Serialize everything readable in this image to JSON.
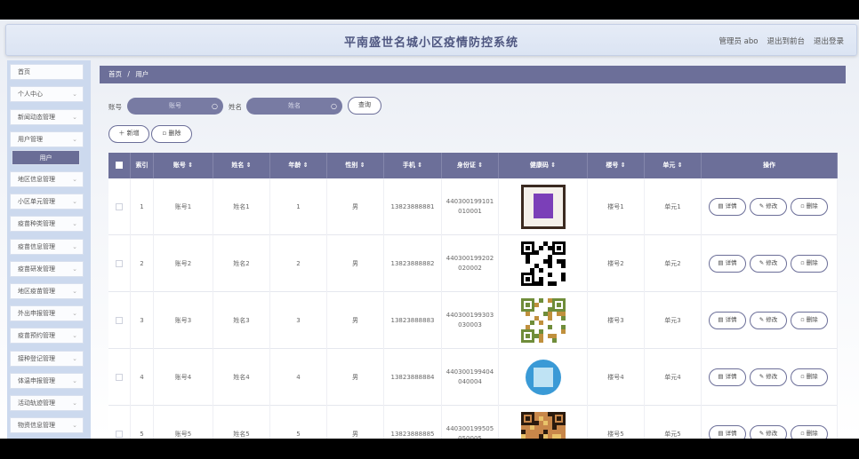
{
  "header": {
    "title": "平南盛世名城小区疫情防控系统",
    "user": "管理员 abo",
    "to_backend": "退出到前台",
    "logout": "退出登录"
  },
  "sidebar": {
    "items": [
      {
        "label": "首页",
        "chevron": false
      },
      {
        "label": "个人中心",
        "chevron": true
      },
      {
        "label": "新闻动态管理",
        "chevron": true
      },
      {
        "label": "用户管理",
        "chevron": true
      },
      {
        "label": "用户",
        "chevron": false,
        "active": true
      },
      {
        "label": "地区信息管理",
        "chevron": true
      },
      {
        "label": "小区单元管理",
        "chevron": true
      },
      {
        "label": "疫苗种类管理",
        "chevron": true
      },
      {
        "label": "疫苗信息管理",
        "chevron": true
      },
      {
        "label": "疫苗研发管理",
        "chevron": true
      },
      {
        "label": "地区疫苗管理",
        "chevron": true
      },
      {
        "label": "外出申报管理",
        "chevron": true
      },
      {
        "label": "疫苗预约管理",
        "chevron": true
      },
      {
        "label": "接种登记管理",
        "chevron": true
      },
      {
        "label": "体温申报管理",
        "chevron": true
      },
      {
        "label": "活动轨迹管理",
        "chevron": true
      },
      {
        "label": "物资信息管理",
        "chevron": true
      }
    ]
  },
  "breadcrumb": {
    "home": "首页",
    "sep": "/",
    "current": "用户"
  },
  "search": {
    "account_label": "账号",
    "account_placeholder": "账号",
    "name_label": "姓名",
    "name_placeholder": "姓名",
    "query_button": "查询"
  },
  "toolbar": {
    "add_button": "新增",
    "delete_button": "删除"
  },
  "table": {
    "columns": [
      "索引",
      "账号",
      "姓名",
      "年龄",
      "性别",
      "手机",
      "身份证",
      "健康码",
      "楼号",
      "单元",
      "操作"
    ],
    "sortable": [
      false,
      true,
      true,
      true,
      true,
      true,
      true,
      true,
      true,
      true,
      false
    ],
    "actions": {
      "detail": "详情",
      "edit": "修改",
      "delete": "删除"
    },
    "rows": [
      {
        "index": "1",
        "account": "账号1",
        "name": "姓名1",
        "age": "1",
        "gender": "男",
        "phone": "13823888881",
        "id_card_a": "440300199101",
        "id_card_b": "010001",
        "building": "楼号1",
        "unit": "单元1"
      },
      {
        "index": "2",
        "account": "账号2",
        "name": "姓名2",
        "age": "2",
        "gender": "男",
        "phone": "13823888882",
        "id_card_a": "440300199202",
        "id_card_b": "020002",
        "building": "楼号2",
        "unit": "单元2"
      },
      {
        "index": "3",
        "account": "账号3",
        "name": "姓名3",
        "age": "3",
        "gender": "男",
        "phone": "13823888883",
        "id_card_a": "440300199303",
        "id_card_b": "030003",
        "building": "楼号3",
        "unit": "单元3"
      },
      {
        "index": "4",
        "account": "账号4",
        "name": "姓名4",
        "age": "4",
        "gender": "男",
        "phone": "13823888884",
        "id_card_a": "440300199404",
        "id_card_b": "040004",
        "building": "楼号4",
        "unit": "单元4"
      },
      {
        "index": "5",
        "account": "账号5",
        "name": "姓名5",
        "age": "5",
        "gender": "男",
        "phone": "13823888885",
        "id_card_a": "440300199505",
        "id_card_b": "050005",
        "building": "楼号5",
        "unit": "单元5"
      }
    ]
  },
  "colors": {
    "accent": "#6c6f99",
    "sidebar_bg": "#ccd9ee",
    "header_title": "#4e5680"
  }
}
